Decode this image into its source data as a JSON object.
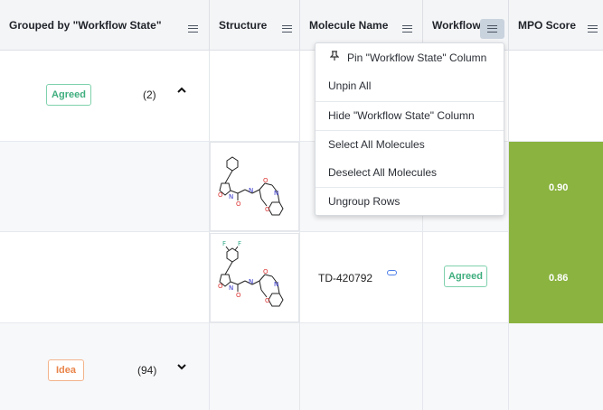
{
  "header": {
    "group_col": "Grouped by \"Workflow State\"",
    "structure_col": "Structure",
    "molecule_col": "Molecule Name",
    "workflow_col": "Workflow",
    "mpo_col": "MPO Score"
  },
  "groups": [
    {
      "badge": "Agreed",
      "count": "(2)",
      "chevron": "^"
    },
    {
      "badge": "Idea",
      "count": "(94)",
      "chevron": "v"
    }
  ],
  "rows": [
    {
      "molecule_name": "",
      "workflow": "",
      "mpo": "0.90"
    },
    {
      "molecule_name": "TD-420792",
      "workflow": "Agreed",
      "mpo": "0.86"
    }
  ],
  "menu": {
    "items": [
      "Pin \"Workflow State\" Column",
      "Unpin All",
      "Hide \"Workflow State\" Column",
      "Select All Molecules",
      "Deselect All Molecules",
      "Ungroup Rows"
    ]
  },
  "colors": {
    "mpo_green": "#8ab33f",
    "agreed": "#3fae7e",
    "idea": "#e9844a",
    "header_bg": "#f4f5f7"
  },
  "icons": [
    "menu-icon",
    "pin-icon",
    "link-icon",
    "chevron-up-icon",
    "chevron-down-icon"
  ]
}
